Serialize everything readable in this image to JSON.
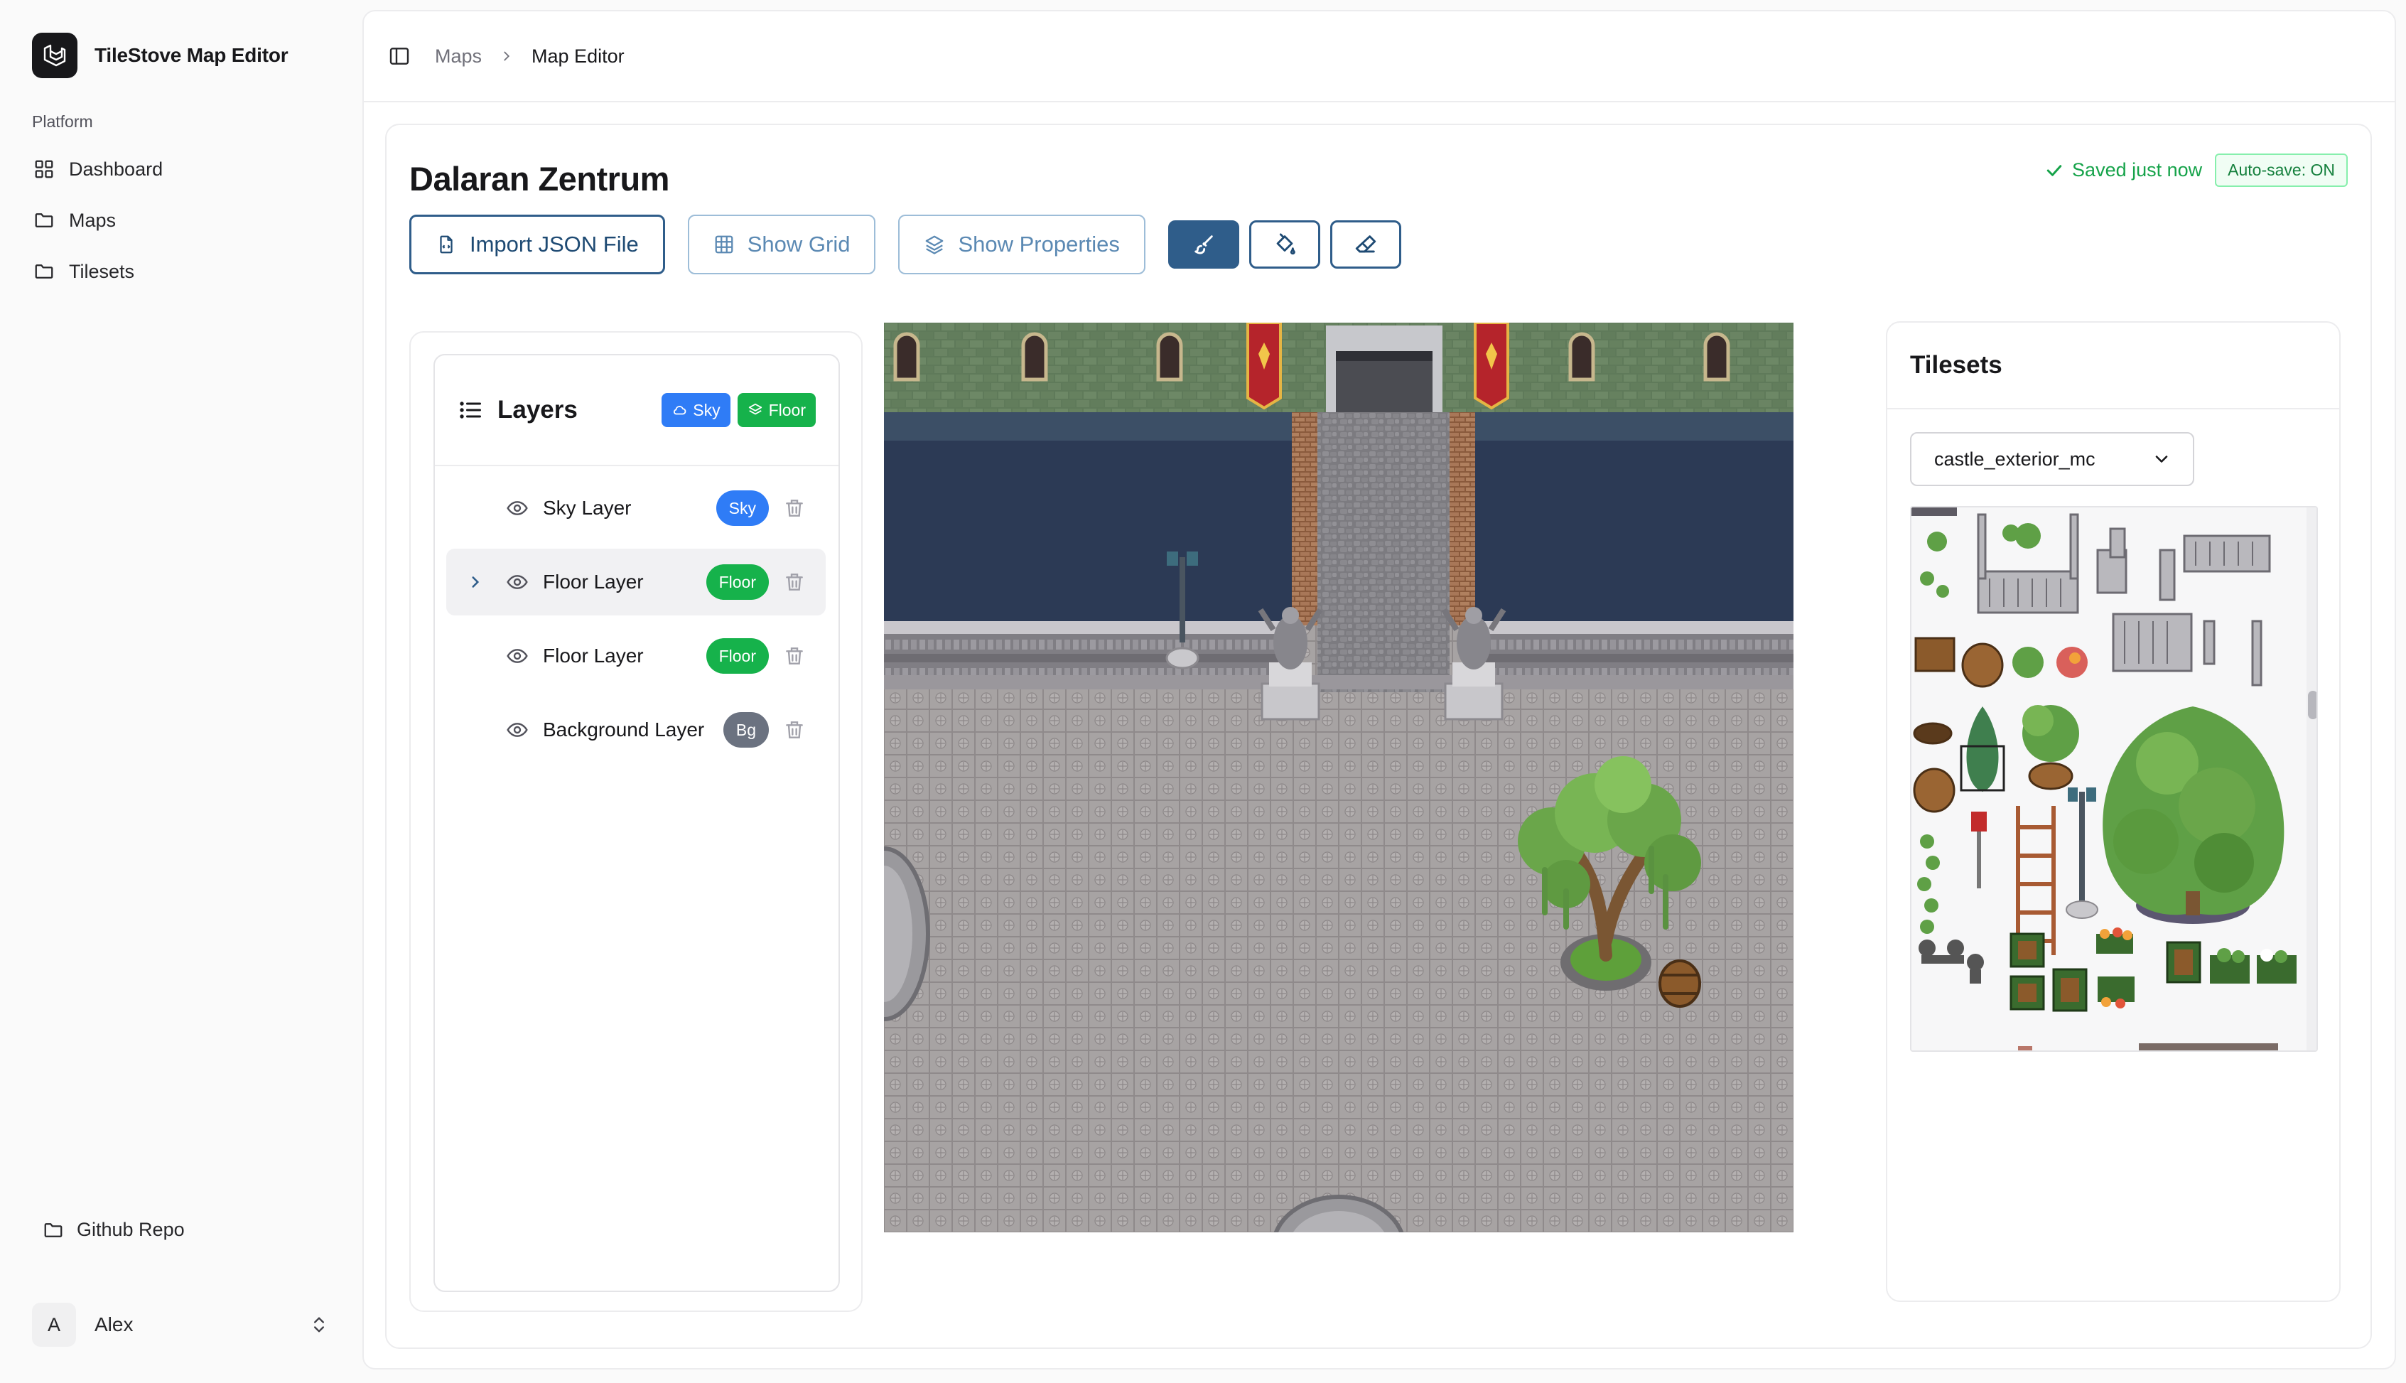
{
  "app": {
    "name": "TileStove Map Editor"
  },
  "sidebar": {
    "group_label": "Platform",
    "items": [
      {
        "label": "Dashboard",
        "icon": "grid-icon"
      },
      {
        "label": "Maps",
        "icon": "folder-icon"
      },
      {
        "label": "Tilesets",
        "icon": "folder-icon"
      }
    ],
    "footer_link": "Github Repo",
    "user": {
      "initial": "A",
      "name": "Alex"
    }
  },
  "breadcrumb": {
    "parent": "Maps",
    "current": "Map Editor"
  },
  "editor": {
    "title": "Dalaran Zentrum",
    "save_status": "Saved just now",
    "autosave": "Auto-save: ON",
    "toolbar": {
      "import_label": "Import JSON File",
      "grid_label": "Show Grid",
      "properties_label": "Show Properties",
      "active_tool": "brush"
    }
  },
  "layers": {
    "title": "Layers",
    "header_badges": [
      {
        "label": "Sky",
        "icon": "cloud-icon"
      },
      {
        "label": "Floor",
        "icon": "layers-icon"
      }
    ],
    "items": [
      {
        "name": "Sky Layer",
        "badge": "Sky",
        "selected": false,
        "expandable": false
      },
      {
        "name": "Floor Layer",
        "badge": "Floor",
        "selected": true,
        "expandable": true
      },
      {
        "name": "Floor Layer",
        "badge": "Floor",
        "selected": false,
        "expandable": false
      },
      {
        "name": "Background Layer",
        "badge": "Bg",
        "selected": false,
        "expandable": false
      }
    ]
  },
  "tilesets": {
    "title": "Tilesets",
    "selected": "castle_exterior_mc"
  },
  "colors": {
    "accent": "#2f5d8a",
    "sky_badge": "#2f7cf6",
    "floor_badge": "#16b24b",
    "bg_badge": "#6b7280",
    "saved": "#16a34a"
  }
}
